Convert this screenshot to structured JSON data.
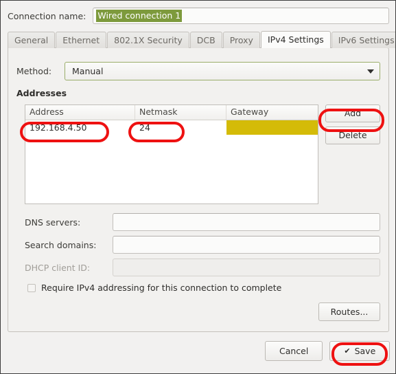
{
  "dialog": {
    "connection_name": {
      "label": "Connection name:",
      "value": "Wired connection 1"
    },
    "tabs": [
      {
        "label": "General",
        "active": false
      },
      {
        "label": "Ethernet",
        "active": false
      },
      {
        "label": "802.1X Security",
        "active": false
      },
      {
        "label": "DCB",
        "active": false
      },
      {
        "label": "Proxy",
        "active": false
      },
      {
        "label": "IPv4 Settings",
        "active": true
      },
      {
        "label": "IPv6 Settings",
        "active": false
      }
    ],
    "method": {
      "label": "Method:",
      "value": "Manual",
      "arrow_icon": "chevron-down-icon"
    },
    "addresses": {
      "title": "Addresses",
      "columns": [
        "Address",
        "Netmask",
        "Gateway"
      ],
      "rows": [
        {
          "address": "192.168.4.50",
          "netmask": "24",
          "gateway": ""
        }
      ],
      "gateway_cell_color": "#d4bb08",
      "add_label": "Add",
      "delete_label": "Delete"
    },
    "fields": [
      {
        "label": "DNS servers:",
        "value": "",
        "disabled": false
      },
      {
        "label": "Search domains:",
        "value": "",
        "disabled": false
      },
      {
        "label": "DHCP client ID:",
        "value": "",
        "disabled": true
      }
    ],
    "require_ipv4": {
      "label": "Require IPv4 addressing for this connection to complete",
      "checked": false
    },
    "routes_label": "Routes...",
    "cancel_label": "Cancel",
    "save_label": "Save",
    "save_icon": "✔"
  },
  "annotation_color": "#ee1111"
}
